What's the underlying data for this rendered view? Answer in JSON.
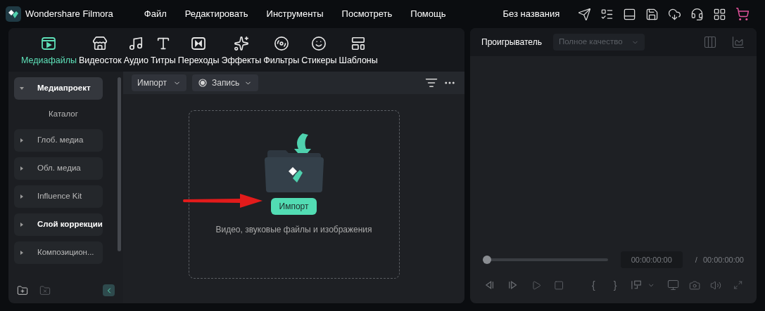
{
  "app": {
    "title": "Wondershare Filmora"
  },
  "menu": [
    "Файл",
    "Редактировать",
    "Инструменты",
    "Посмотреть",
    "Помощь"
  ],
  "project_title": "Без названия",
  "tabs": [
    {
      "label": "Медиафайлы",
      "selected": true
    },
    {
      "label": "Видеосток",
      "selected": false
    },
    {
      "label": "Аудио",
      "selected": false
    },
    {
      "label": "Титры",
      "selected": false
    },
    {
      "label": "Переходы",
      "selected": false
    },
    {
      "label": "Эффекты",
      "selected": false
    },
    {
      "label": "Фильтры",
      "selected": false
    },
    {
      "label": "Стикеры",
      "selected": false
    },
    {
      "label": "Шаблоны",
      "selected": false
    }
  ],
  "sidebar": {
    "items": [
      {
        "label": "Медиапроект",
        "selected": true,
        "expanded": true,
        "emphasized": true,
        "children": [
          {
            "label": "Каталог"
          }
        ]
      },
      {
        "label": "Глоб. медиа",
        "selected": false,
        "expanded": false,
        "emphasized": false
      },
      {
        "label": "Обл. медиа",
        "selected": false,
        "expanded": false,
        "emphasized": false
      },
      {
        "label": "Influence Kit",
        "selected": false,
        "expanded": false,
        "emphasized": false
      },
      {
        "label": "Слой коррекции",
        "selected": false,
        "expanded": false,
        "emphasized": true
      },
      {
        "label": "Композицион...",
        "selected": false,
        "expanded": false,
        "emphasized": false
      }
    ]
  },
  "media_toolbar": {
    "import_label": "Импорт",
    "record_label": "Запись"
  },
  "drop_zone": {
    "button": "Импорт",
    "hint": "Видео, звуковые файлы и изображения"
  },
  "player": {
    "title": "Проигрыватель",
    "quality_placeholder": "Полное качество",
    "progress": {
      "level": 0
    },
    "current_time": "00:00:00:00",
    "separator": "/",
    "total_time": "00:00:00:00",
    "mark_in": "{",
    "mark_out": "}"
  }
}
